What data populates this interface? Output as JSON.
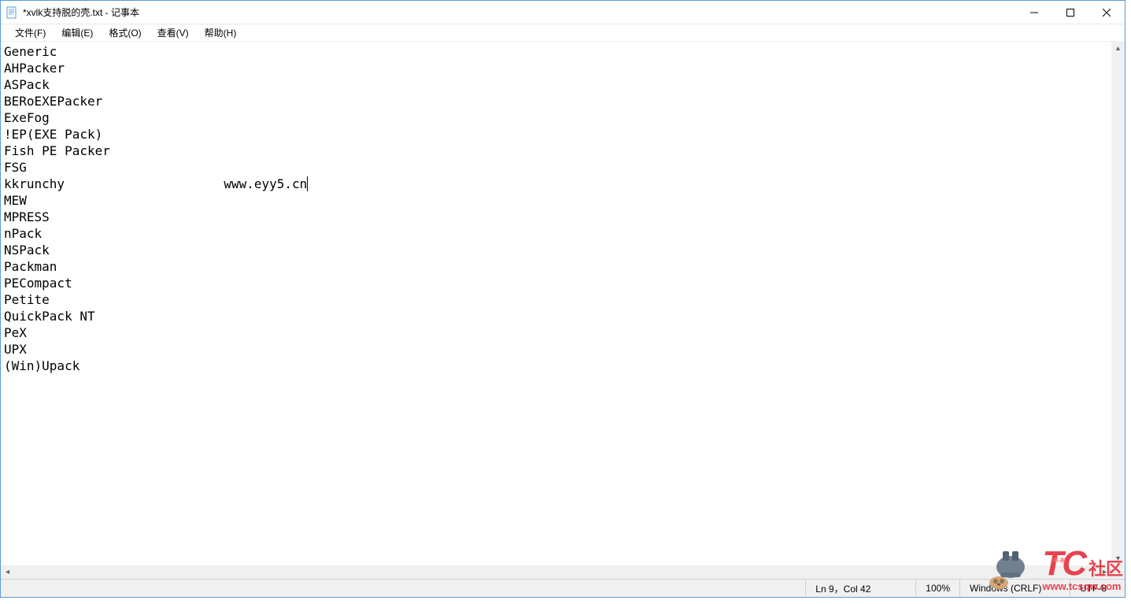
{
  "window": {
    "title": "*xvlk支持脱的壳.txt - 记事本"
  },
  "menu": {
    "file": "文件(F)",
    "edit": "编辑(E)",
    "format": "格式(O)",
    "view": "查看(V)",
    "help": "帮助(H)"
  },
  "content": {
    "lines": [
      "Generic",
      "AHPacker",
      "ASPack",
      "BERoEXEPacker",
      "ExeFog",
      "!EP(EXE Pack)",
      "Fish PE Packer",
      "FSG",
      "kkrunchy                     www.eyy5.cn",
      "MEW",
      "MPRESS",
      "nPack",
      "NSPack",
      "Packman",
      "PECompact",
      "Petite",
      "QuickPack NT",
      "PeX",
      "UPX",
      "(Win)Upack"
    ],
    "cursor_line_index": 8
  },
  "statusbar": {
    "position": "Ln 9，Col 42",
    "zoom": "100%",
    "lineending": "Windows (CRLF)",
    "encoding": "UTF-8"
  },
  "watermark": {
    "tc": "TC",
    "cn": "社区",
    "url": "www.tcsqw.com"
  }
}
